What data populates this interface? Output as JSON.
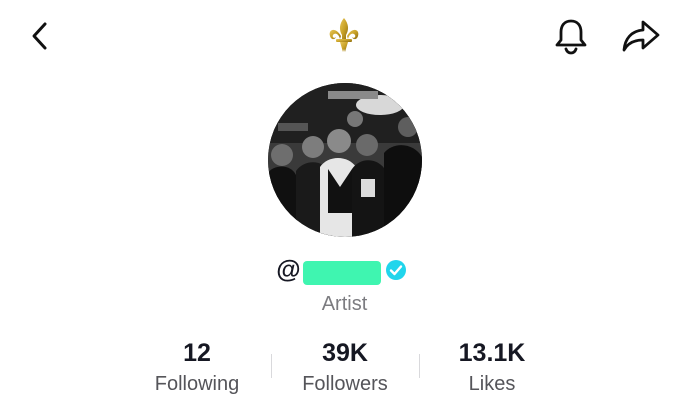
{
  "header": {
    "back_icon": "chevron-left-icon",
    "brand_icon": "fleur-de-lis-icon",
    "bell_icon": "bell-icon",
    "share_icon": "share-arrow-icon"
  },
  "profile": {
    "at_symbol": "@",
    "verified_icon": "verified-check-icon",
    "bio": "Artist",
    "colors": {
      "verified": "#20d5ec",
      "redaction": "#3ff5b0",
      "logo_gold": "#c9a227"
    }
  },
  "stats": [
    {
      "value": "12",
      "label": "Following"
    },
    {
      "value": "39K",
      "label": "Followers"
    },
    {
      "value": "13.1K",
      "label": "Likes"
    }
  ]
}
